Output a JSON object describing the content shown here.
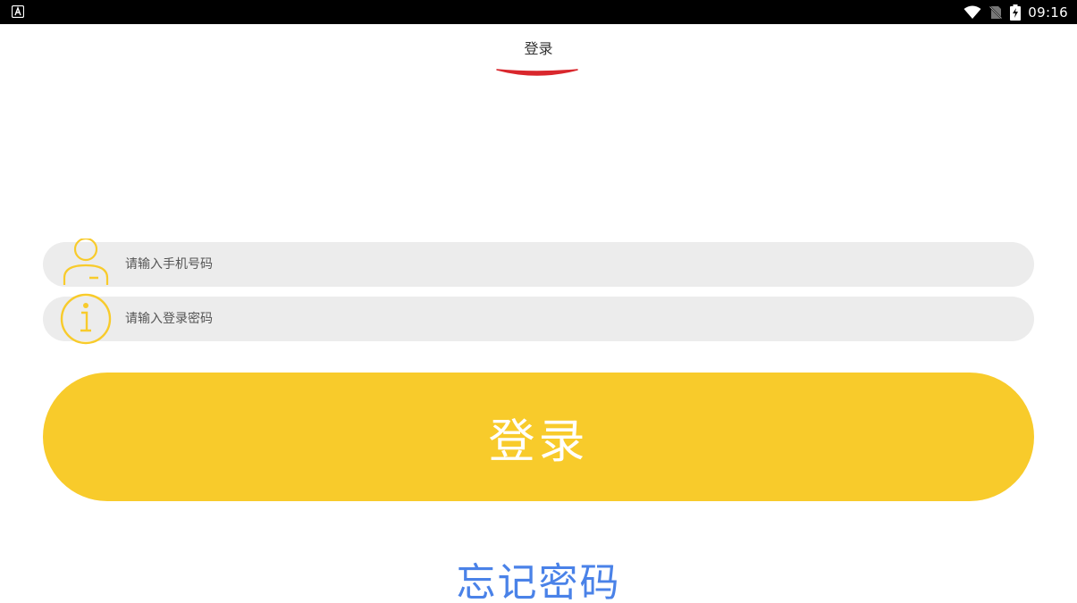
{
  "status_bar": {
    "time": "09:16",
    "left_icon": "app-notification-icon",
    "icons": [
      "wifi-icon",
      "no-sim-icon",
      "battery-charging-icon"
    ]
  },
  "header": {
    "title": "登录"
  },
  "form": {
    "phone": {
      "placeholder": "请输入手机号码",
      "value": "",
      "icon": "user-icon"
    },
    "password": {
      "placeholder": "请输入登录密码",
      "value": "",
      "icon": "info-icon"
    }
  },
  "actions": {
    "login_label": "登录",
    "forgot_label": "忘记密码"
  },
  "colors": {
    "accent": "#f8cb2b",
    "underline": "#d9272d",
    "link": "#4a82e8",
    "input_bg": "#ececec"
  }
}
